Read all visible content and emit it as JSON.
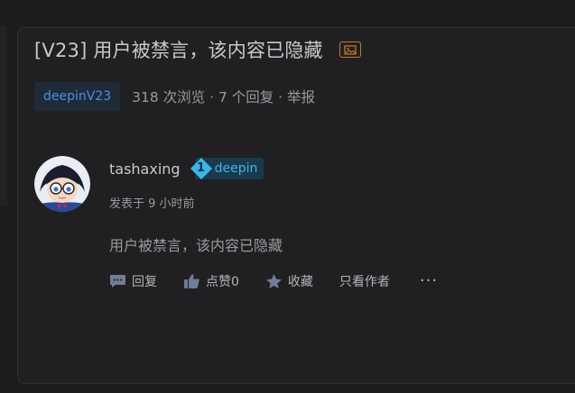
{
  "post": {
    "title": "[V23] 用户被禁言，该内容已隐藏",
    "tag": "deepinV23",
    "stats": "318 次浏览 · 7 个回复 · 举报"
  },
  "author": {
    "username": "tashaxing",
    "level": "1",
    "level_label": "deepin",
    "post_time": "发表于 9 小时前"
  },
  "body": {
    "content": "用户被禁言，该内容已隐藏"
  },
  "actions": {
    "reply": "回复",
    "like": "点赞0",
    "favorite": "收藏",
    "author_only": "只看作者",
    "more": "···"
  },
  "colors": {
    "background": "#1c1c1e",
    "card": "#202022",
    "tag_text": "#4a90e2",
    "badge_accent": "#3fb5e6",
    "image_icon": "#c27a2a"
  },
  "icons": {
    "title_badge": "image-icon",
    "reply": "comment-icon",
    "like": "thumbs-up-icon",
    "favorite": "star-icon"
  }
}
